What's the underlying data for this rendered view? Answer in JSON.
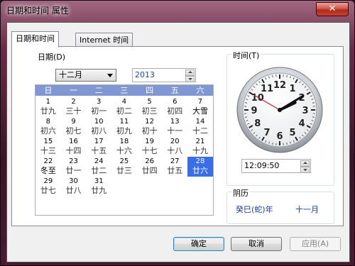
{
  "window": {
    "title": "日期和时间 属性",
    "close_label": "✕"
  },
  "tabs": [
    {
      "label": "日期和时间"
    },
    {
      "label": "Internet 时间"
    }
  ],
  "date_group": {
    "label": "日期(D)",
    "month": "十二月",
    "year": "2013",
    "weekdays": [
      "日",
      "一",
      "二",
      "三",
      "四",
      "五",
      "六"
    ],
    "days": [
      {
        "d": "1",
        "l": "廿九"
      },
      {
        "d": "2",
        "l": "三十"
      },
      {
        "d": "3",
        "l": "初一"
      },
      {
        "d": "4",
        "l": "初二"
      },
      {
        "d": "5",
        "l": "初三"
      },
      {
        "d": "6",
        "l": "初四"
      },
      {
        "d": "7",
        "l": "大雪"
      },
      {
        "d": "8",
        "l": "初六"
      },
      {
        "d": "9",
        "l": "初七"
      },
      {
        "d": "10",
        "l": "初八"
      },
      {
        "d": "11",
        "l": "初九"
      },
      {
        "d": "12",
        "l": "初十"
      },
      {
        "d": "13",
        "l": "十一"
      },
      {
        "d": "14",
        "l": "十二"
      },
      {
        "d": "15",
        "l": "十三"
      },
      {
        "d": "16",
        "l": "十四"
      },
      {
        "d": "17",
        "l": "十五"
      },
      {
        "d": "18",
        "l": "十六"
      },
      {
        "d": "19",
        "l": "十七"
      },
      {
        "d": "20",
        "l": "十八"
      },
      {
        "d": "21",
        "l": "十九"
      },
      {
        "d": "22",
        "l": "冬至"
      },
      {
        "d": "23",
        "l": "廿一"
      },
      {
        "d": "24",
        "l": "廿二"
      },
      {
        "d": "25",
        "l": "廿三"
      },
      {
        "d": "26",
        "l": "廿四"
      },
      {
        "d": "27",
        "l": "廿五"
      },
      {
        "d": "28",
        "l": "廿六"
      },
      {
        "d": "29",
        "l": "廿七"
      },
      {
        "d": "30",
        "l": "廿八"
      },
      {
        "d": "31",
        "l": "廿九"
      }
    ],
    "selected_day": "28",
    "term_days": [
      "7",
      "22"
    ]
  },
  "time_group": {
    "label": "时间(T)",
    "time": "12:09:50",
    "clock_numbers": [
      "12",
      "1",
      "2",
      "3",
      "4",
      "5",
      "6",
      "7",
      "8",
      "9",
      "10",
      "11"
    ]
  },
  "lunar_group": {
    "label": "阴历",
    "year_text": "癸巳(蛇)年",
    "month_text": "十一月"
  },
  "buttons": {
    "ok": "确定",
    "cancel": "取消",
    "apply": "应用(A)"
  },
  "colors": {
    "selection": "#3a6ee8",
    "calendar_header": "#7f97d2",
    "title_bar": "#6a2a48"
  }
}
